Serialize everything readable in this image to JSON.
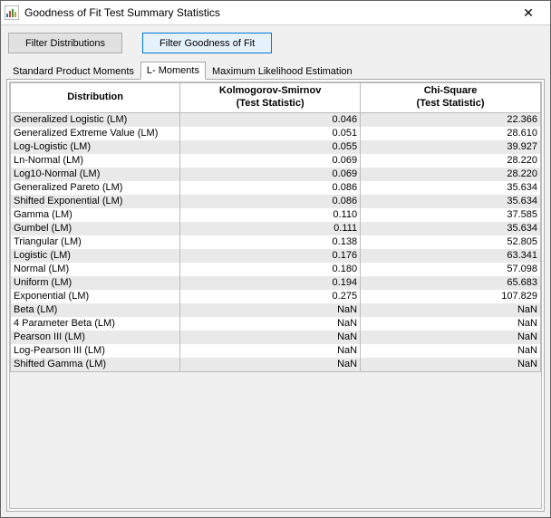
{
  "window": {
    "title": "Goodness of Fit Test Summary Statistics",
    "close_glyph": "✕"
  },
  "toolbar": {
    "filter_distributions": "Filter Distributions",
    "filter_goodness": "Filter Goodness of Fit"
  },
  "tabs": {
    "std": "Standard Product Moments",
    "lm": "L- Moments",
    "mle": "Maximum Likelihood Estimation"
  },
  "table": {
    "headers": {
      "dist": "Distribution",
      "ks_line1": "Kolmogorov-Smirnov",
      "ks_line2": "(Test Statistic)",
      "cs_line1": "Chi-Square",
      "cs_line2": "(Test Statistic)"
    },
    "rows": [
      {
        "name": "Generalized Logistic (LM)",
        "ks": "0.046",
        "cs": "22.366"
      },
      {
        "name": "Generalized Extreme Value (LM)",
        "ks": "0.051",
        "cs": "28.610"
      },
      {
        "name": "Log-Logistic (LM)",
        "ks": "0.055",
        "cs": "39.927"
      },
      {
        "name": "Ln-Normal (LM)",
        "ks": "0.069",
        "cs": "28.220"
      },
      {
        "name": "Log10-Normal (LM)",
        "ks": "0.069",
        "cs": "28.220"
      },
      {
        "name": "Generalized Pareto (LM)",
        "ks": "0.086",
        "cs": "35.634"
      },
      {
        "name": "Shifted Exponential (LM)",
        "ks": "0.086",
        "cs": "35.634"
      },
      {
        "name": "Gamma (LM)",
        "ks": "0.110",
        "cs": "37.585"
      },
      {
        "name": "Gumbel (LM)",
        "ks": "0.111",
        "cs": "35.634"
      },
      {
        "name": "Triangular (LM)",
        "ks": "0.138",
        "cs": "52.805"
      },
      {
        "name": "Logistic (LM)",
        "ks": "0.176",
        "cs": "63.341"
      },
      {
        "name": "Normal (LM)",
        "ks": "0.180",
        "cs": "57.098"
      },
      {
        "name": "Uniform (LM)",
        "ks": "0.194",
        "cs": "65.683"
      },
      {
        "name": "Exponential (LM)",
        "ks": "0.275",
        "cs": "107.829"
      },
      {
        "name": "Beta (LM)",
        "ks": "NaN",
        "cs": "NaN"
      },
      {
        "name": "4 Parameter Beta (LM)",
        "ks": "NaN",
        "cs": "NaN"
      },
      {
        "name": "Pearson III (LM)",
        "ks": "NaN",
        "cs": "NaN"
      },
      {
        "name": "Log-Pearson III (LM)",
        "ks": "NaN",
        "cs": "NaN"
      },
      {
        "name": "Shifted Gamma (LM)",
        "ks": "NaN",
        "cs": "NaN"
      }
    ]
  }
}
